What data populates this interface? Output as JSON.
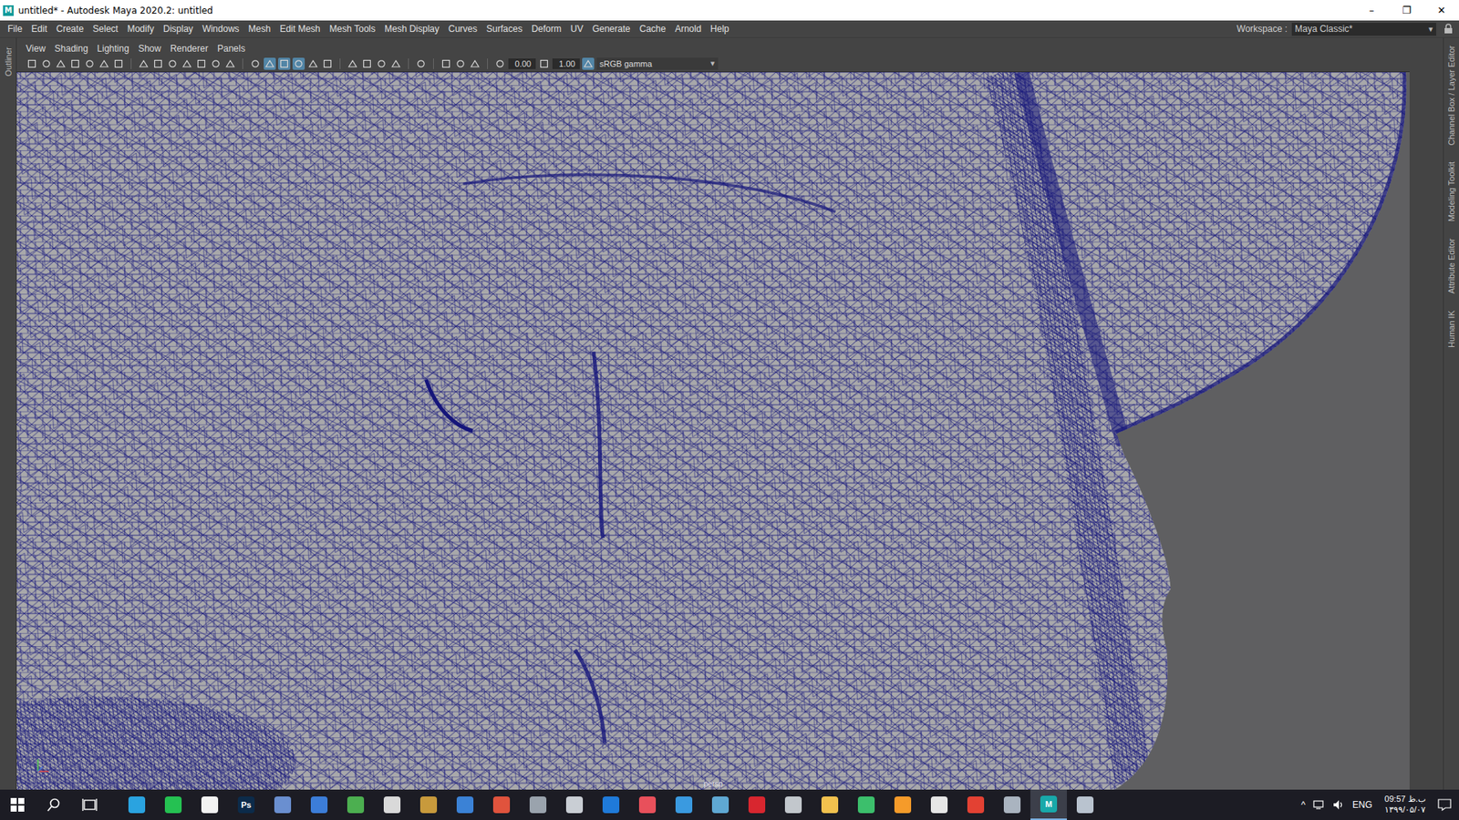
{
  "window": {
    "title": "untitled* - Autodesk Maya 2020.2: untitled",
    "logo": "M",
    "controls": [
      "–",
      "❐",
      "✕"
    ]
  },
  "menu_bar": {
    "items": [
      "File",
      "Edit",
      "Create",
      "Select",
      "Modify",
      "Display",
      "Windows",
      "Mesh",
      "Edit Mesh",
      "Mesh Tools",
      "Mesh Display",
      "Curves",
      "Surfaces",
      "Deform",
      "UV",
      "Generate",
      "Cache",
      "Arnold",
      "Help"
    ],
    "workspace_label": "Workspace :",
    "workspace_value": "Maya Classic*",
    "dropdown_arrow": "▾"
  },
  "left_dock": {
    "tabs": [
      {
        "label": "Outliner"
      }
    ]
  },
  "right_dock": {
    "tabs": [
      {
        "label": "Channel Box / Layer Editor"
      },
      {
        "label": "Modeling Toolkit"
      },
      {
        "label": "Attribute Editor"
      },
      {
        "label": "Human IK"
      }
    ]
  },
  "panel_menu": [
    "View",
    "Shading",
    "Lighting",
    "Show",
    "Renderer",
    "Panels"
  ],
  "panel_toolbar": {
    "items": [
      {
        "kind": "button",
        "active": false
      },
      {
        "kind": "button",
        "active": false
      },
      {
        "kind": "button",
        "active": false
      },
      {
        "kind": "button",
        "active": false
      },
      {
        "kind": "button",
        "active": false
      },
      {
        "kind": "button",
        "active": false
      },
      {
        "kind": "button",
        "active": false
      },
      {
        "kind": "separator"
      },
      {
        "kind": "button",
        "active": false
      },
      {
        "kind": "button",
        "active": false
      },
      {
        "kind": "button",
        "active": false
      },
      {
        "kind": "button",
        "active": false
      },
      {
        "kind": "button",
        "active": false
      },
      {
        "kind": "button",
        "active": false
      },
      {
        "kind": "button",
        "active": false
      },
      {
        "kind": "separator"
      },
      {
        "kind": "button",
        "active": false
      },
      {
        "kind": "button",
        "active": true
      },
      {
        "kind": "button",
        "active": true
      },
      {
        "kind": "button",
        "active": true
      },
      {
        "kind": "button",
        "active": false
      },
      {
        "kind": "button",
        "active": false
      },
      {
        "kind": "separator"
      },
      {
        "kind": "button",
        "active": false
      },
      {
        "kind": "button",
        "active": false
      },
      {
        "kind": "button",
        "active": false
      },
      {
        "kind": "button",
        "active": false
      },
      {
        "kind": "separator"
      },
      {
        "kind": "button",
        "active": false
      },
      {
        "kind": "separator"
      },
      {
        "kind": "button",
        "active": false
      },
      {
        "kind": "button",
        "active": false
      },
      {
        "kind": "button",
        "active": false
      },
      {
        "kind": "separator"
      },
      {
        "kind": "button",
        "active": false
      },
      {
        "kind": "field",
        "value": "0.00"
      },
      {
        "kind": "button",
        "active": false
      },
      {
        "kind": "field",
        "value": "1.00"
      },
      {
        "kind": "button",
        "active": true
      },
      {
        "kind": "colorspace",
        "value": "sRGB gamma",
        "arrow": "▾"
      }
    ]
  },
  "viewport": {
    "camera": "persp"
  },
  "taskbar": {
    "apps": [
      {
        "color": "#2aa3e0",
        "active": false
      },
      {
        "color": "#25c152",
        "active": false
      },
      {
        "color": "#f2f2f2",
        "active": false
      },
      {
        "color": "#0c2b4a",
        "active": false,
        "label": "Ps"
      },
      {
        "color": "#6a8fd0",
        "active": false
      },
      {
        "color": "#3c7dd8",
        "active": false
      },
      {
        "color": "#4caf50",
        "active": false
      },
      {
        "color": "#d9d9d9",
        "active": false
      },
      {
        "color": "#c89a3c",
        "active": false
      },
      {
        "color": "#3b82d6",
        "active": false
      },
      {
        "color": "#e0533d",
        "active": false
      },
      {
        "color": "#9aa3ad",
        "active": false
      },
      {
        "color": "#c9ced4",
        "active": false
      },
      {
        "color": "#1f7ad9",
        "active": false
      },
      {
        "color": "#e8505b",
        "active": false
      },
      {
        "color": "#3a9ae0",
        "active": false
      },
      {
        "color": "#5fa8d3",
        "active": false
      },
      {
        "color": "#d8262f",
        "active": false
      },
      {
        "color": "#c2c7cc",
        "active": false
      },
      {
        "color": "#f2c14e",
        "active": false
      },
      {
        "color": "#3cbf6c",
        "active": false
      },
      {
        "color": "#f59b2a",
        "active": false
      },
      {
        "color": "#e6e6e6",
        "active": false
      },
      {
        "color": "#e34133",
        "active": false
      },
      {
        "color": "#aab4c0",
        "active": false
      },
      {
        "color": "#18a9a9",
        "active": true,
        "label": "M"
      },
      {
        "color": "#b9c3cf",
        "active": false
      }
    ],
    "tray": {
      "chevron": "^",
      "language": "ENG",
      "time": "09:57 ب.ظ",
      "date": "۱۳۹۹/۰۵/۰۷"
    }
  }
}
